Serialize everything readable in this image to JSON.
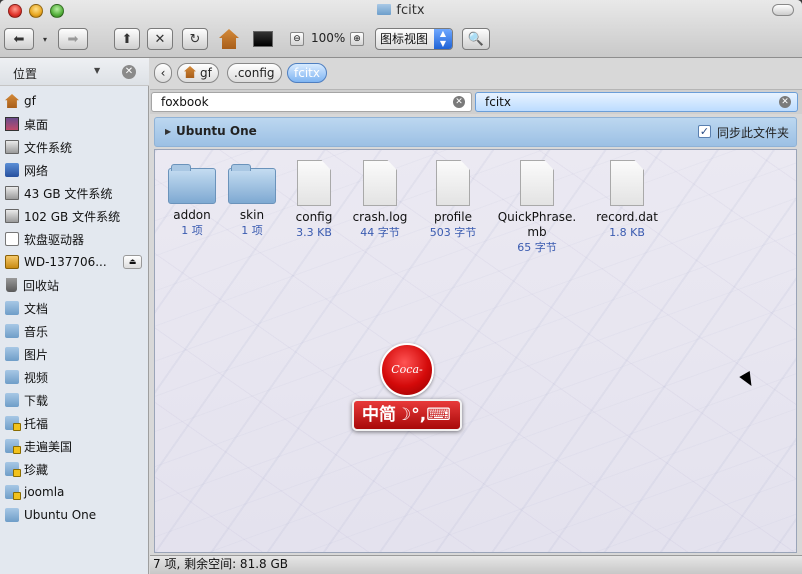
{
  "window": {
    "title": "fcitx"
  },
  "toolbar": {
    "zoom_label": "100%",
    "zoom_out": "⊖",
    "zoom_in": "⊕",
    "view_mode": "图标视图"
  },
  "sidebar": {
    "header": "位置",
    "items": [
      {
        "label": "gf",
        "icon": "home-icon"
      },
      {
        "label": "桌面",
        "icon": "desktop-icon"
      },
      {
        "label": "文件系统",
        "icon": "drive-icon"
      },
      {
        "label": "网络",
        "icon": "network-icon"
      },
      {
        "label": "43 GB 文件系统",
        "icon": "drive-icon"
      },
      {
        "label": "102 GB 文件系统",
        "icon": "drive-icon"
      },
      {
        "label": "软盘驱动器",
        "icon": "floppy-icon"
      },
      {
        "label": "WD-137706...",
        "icon": "external-drive-icon"
      },
      {
        "label": "回收站",
        "icon": "trash-icon"
      },
      {
        "label": "文档",
        "icon": "folder-icon"
      },
      {
        "label": "音乐",
        "icon": "folder-icon"
      },
      {
        "label": "图片",
        "icon": "folder-icon"
      },
      {
        "label": "视频",
        "icon": "folder-icon"
      },
      {
        "label": "下载",
        "icon": "folder-icon"
      },
      {
        "label": "托福",
        "icon": "folder-lock-icon"
      },
      {
        "label": "走遍美国",
        "icon": "folder-lock-icon"
      },
      {
        "label": "珍藏",
        "icon": "folder-lock-icon"
      },
      {
        "label": "joomla",
        "icon": "folder-lock-icon"
      },
      {
        "label": "Ubuntu One",
        "icon": "folder-icon"
      }
    ]
  },
  "path": {
    "crumbs": [
      "gf",
      ".config",
      "fcitx"
    ]
  },
  "tabs": [
    {
      "label": "foxbook",
      "active": false
    },
    {
      "label": "fcitx",
      "active": true
    }
  ],
  "ubuntu_one": {
    "name": "Ubuntu One",
    "sync_label": "同步此文件夹",
    "sync_checked": true
  },
  "files": [
    {
      "name": "addon",
      "size": "1 项",
      "type": "folder"
    },
    {
      "name": "skin",
      "size": "1 项",
      "type": "folder"
    },
    {
      "name": "config",
      "size": "3.3 KB",
      "type": "doc"
    },
    {
      "name": "crash.log",
      "size": "44 字节",
      "type": "doc"
    },
    {
      "name": "profile",
      "size": "503 字节",
      "type": "doc"
    },
    {
      "name": "QuickPhrase.\nmb",
      "size": "65 字节",
      "type": "doc"
    },
    {
      "name": "record.dat",
      "size": "1.8 KB",
      "type": "doc"
    }
  ],
  "overlay": {
    "logo_text": "Coca-Cola",
    "ime_text": "中简☽°,⌨"
  },
  "status": {
    "text": "7 项, 剩余空间: 81.8 GB"
  },
  "colors": {
    "accent": "#4f7fc0",
    "size_text": "#3a5bb0"
  }
}
